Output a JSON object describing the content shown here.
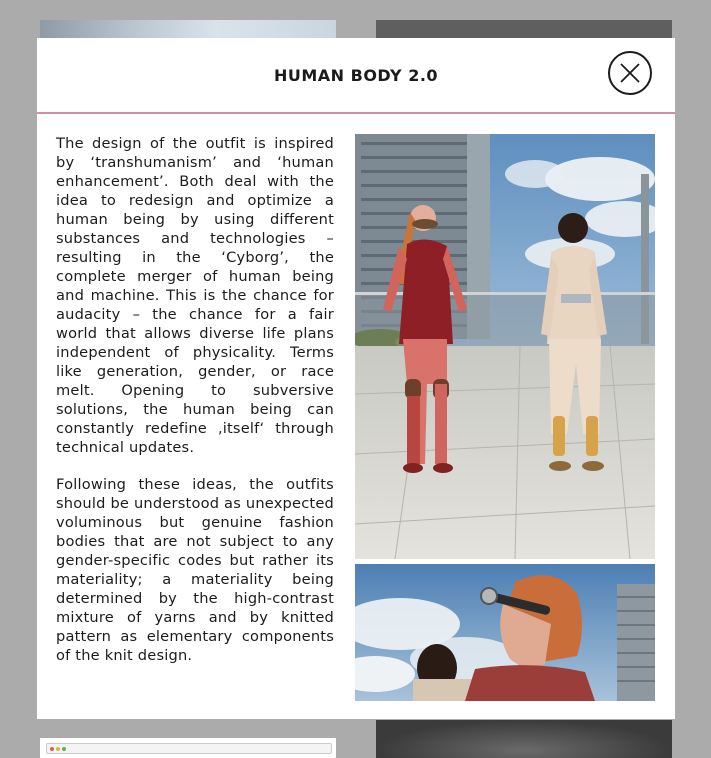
{
  "modal": {
    "title": "HUMAN BODY 2.0",
    "close_icon": "close-icon",
    "accent_color": "#d98aa8",
    "paragraphs": [
      "The design of the outfit is inspired by ‘transhumanism’ and ‘human enhancement’. Both deal with the idea to redesign and optimize a human being by using different substances and technologies – resulting in the ‘Cyborg’, the complete merger of human being and machine. This is the chance for audacity – the chance for a fair world that allows diverse life plans independent of physicality. Terms like generation, gender, or race melt. Opening to subversive solutions, the human being can constantly redefine ‚itself‘ through technical updates.",
      "Following these ideas, the outfits should be understood as unexpected voluminous but genuine fashion bodies that are not subject to any gender-specific codes but rather its materiality; a materiality being determined by the high-contrast mixture of yarns and by knitted pattern as elementary components of the knit design."
    ]
  },
  "background": {
    "overlay_color": "#ababab",
    "browser_thumbnail_url": "lunaris.com"
  }
}
